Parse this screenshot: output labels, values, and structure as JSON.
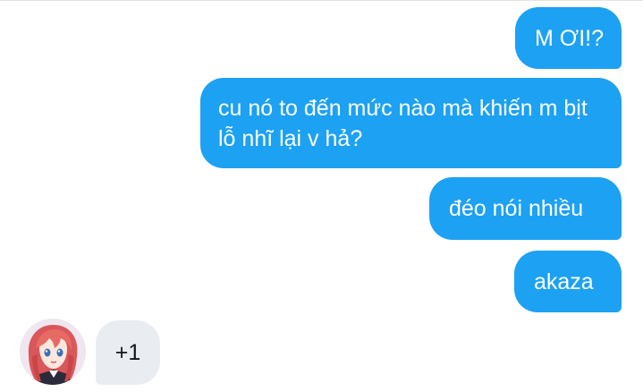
{
  "conversation": {
    "messages_out": [
      {
        "text": "M ƠI!?"
      },
      {
        "text": "cu nó to đến mức nào mà khiến m bịt lỗ nhĩ lại v hả?"
      },
      {
        "text": "đéo nói nhiều"
      },
      {
        "text": "akaza"
      }
    ],
    "message_in": {
      "text": "+1"
    },
    "colors": {
      "outgoing_bubble": "#1da1f2",
      "incoming_bubble": "#e9edf1"
    },
    "avatar_icon": "anime-avatar-icon"
  }
}
